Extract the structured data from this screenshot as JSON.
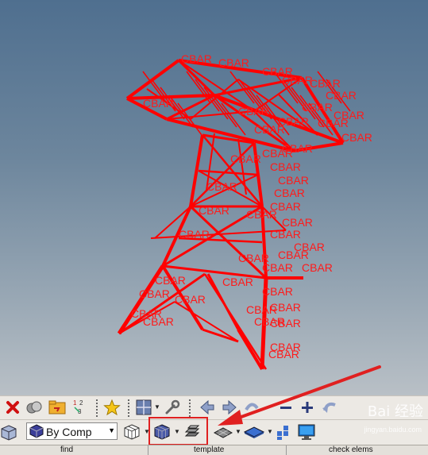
{
  "viewport": {
    "element_label": "CBAR",
    "colors": {
      "mesh": "#ff0000",
      "bg_top": "#4f6f8f",
      "bg_bottom": "#b9c0c6"
    }
  },
  "toolbar": {
    "row1_icons": [
      "delete-icon",
      "mask-icon",
      "folder-icon",
      "numbers-icon",
      "star-icon",
      "view-layout-icon",
      "wrench-icon",
      "arrow-left-icon",
      "arrow-right-icon",
      "rotate-icon",
      "minus-icon",
      "plus-icon",
      "undo-arc-icon"
    ],
    "row2_icons": [
      "cube-icon",
      "color-cube-icon",
      "wireframe-cube-icon",
      "shaded-cube-icon",
      "element-layers-icon",
      "plane-icon",
      "shaded-plane-icon",
      "grid-icon",
      "monitor-icon"
    ],
    "color_mode": {
      "value": "By Comp"
    }
  },
  "tabs": [
    "find",
    "template",
    "check elems"
  ],
  "watermark": {
    "main": "Bai 经验",
    "sub": "jingyan.baidu.com"
  },
  "annotation": {
    "color": "#e02020"
  }
}
